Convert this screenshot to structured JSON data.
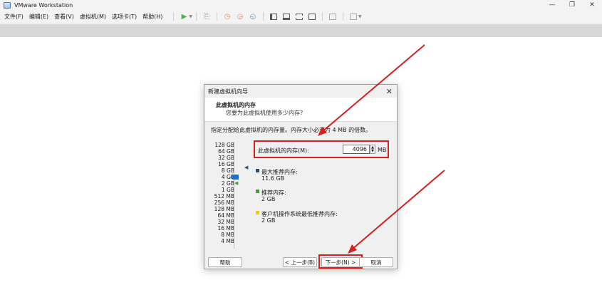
{
  "window": {
    "title": "VMware Workstation",
    "controls": {
      "minimize": "—",
      "restore": "❐",
      "close": "✕"
    }
  },
  "menu": {
    "items": [
      "文件(F)",
      "编辑(E)",
      "查看(V)",
      "虚拟机(M)",
      "选项卡(T)",
      "帮助(H)"
    ]
  },
  "toolbar": {
    "icons": [
      "play-icon",
      "send-keys-icon",
      "snapshot-icon",
      "revert-snapshot-icon",
      "snapshot-manager-icon",
      "library-view-icon",
      "thumbnail-view-icon",
      "fullscreen-icon",
      "unity-icon",
      "console-icon",
      "stretch-icon"
    ]
  },
  "dialog": {
    "title": "新建虚拟机向导",
    "close": "✕",
    "header_title": "此虚拟机的内存",
    "header_subtitle": "您要为此虚拟机使用多少内存?",
    "instruction": "指定分配给此虚拟机的内存量。内存大小必须为 4 MB 的倍数。",
    "memory_label": "此虚拟机的内存(M):",
    "memory_value": "4096",
    "memory_unit": "MB",
    "scale_labels": [
      "128 GB",
      "64 GB",
      "32 GB",
      "16 GB",
      "8 GB",
      "4 GB",
      "2 GB",
      "1 GB",
      "512 MB",
      "256 MB",
      "128 MB",
      "64 MB",
      "32 MB",
      "16 MB",
      "8 MB",
      "4 MB"
    ],
    "legend": {
      "max_title": "最大推荐内存:",
      "max_value": "11.6 GB",
      "rec_title": "推荐内存:",
      "rec_value": "2 GB",
      "min_title": "客户机操作系统最低推荐内存:",
      "min_value": "2 GB"
    },
    "buttons": {
      "help": "帮助",
      "back": "< 上一步(B)",
      "next": "下一步(N) >",
      "cancel": "取消"
    },
    "colors": {
      "max": "#1f4f8a",
      "rec": "#4a9a3a",
      "min": "#f2c81c",
      "highlight": "#d62020"
    }
  }
}
